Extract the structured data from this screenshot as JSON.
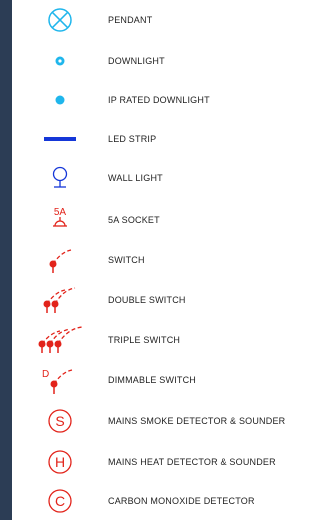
{
  "legend": {
    "items": [
      {
        "label": "PENDANT",
        "icon": "pendant-icon"
      },
      {
        "label": "DOWNLIGHT",
        "icon": "downlight-icon"
      },
      {
        "label": "IP RATED DOWNLIGHT",
        "icon": "ip-downlight-icon"
      },
      {
        "label": "LED STRIP",
        "icon": "led-strip-icon"
      },
      {
        "label": "WALL LIGHT",
        "icon": "wall-light-icon"
      },
      {
        "label": "5A SOCKET",
        "icon": "socket-5a-icon",
        "icon_text": "5A"
      },
      {
        "label": "SWITCH",
        "icon": "switch-icon"
      },
      {
        "label": "DOUBLE SWITCH",
        "icon": "double-switch-icon"
      },
      {
        "label": "TRIPLE SWITCH",
        "icon": "triple-switch-icon"
      },
      {
        "label": "DIMMABLE SWITCH",
        "icon": "dimmable-switch-icon",
        "icon_text": "D"
      },
      {
        "label": "MAINS SMOKE DETECTOR & SOUNDER",
        "icon": "smoke-detector-icon",
        "icon_text": "S"
      },
      {
        "label": "MAINS HEAT DETECTOR & SOUNDER",
        "icon": "heat-detector-icon",
        "icon_text": "H"
      },
      {
        "label": "CARBON MONOXIDE DETECTOR",
        "icon": "co-detector-icon",
        "icon_text": "C"
      }
    ]
  },
  "colors": {
    "cyan": "#1fb6ec",
    "blue": "#1537d8",
    "red": "#e2231a",
    "sidebar": "#2c3d55"
  }
}
